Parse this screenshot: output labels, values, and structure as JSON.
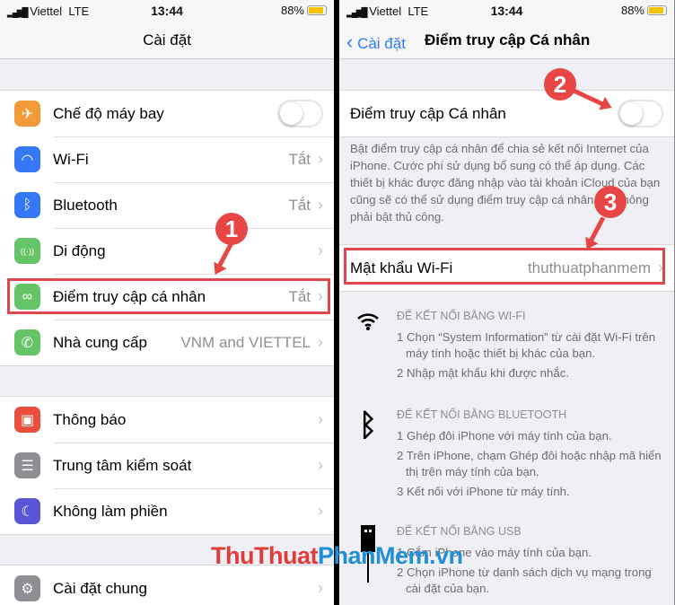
{
  "status": {
    "carrier": "Viettel",
    "network": "LTE",
    "time": "13:44",
    "battery": "88%",
    "battery_level": 0.88
  },
  "left": {
    "title": "Cài đặt",
    "groups": [
      [
        {
          "label": "Chế độ máy bay",
          "icon": "airplane-icon",
          "color": "#f19a37",
          "toggle": false
        },
        {
          "label": "Wi-Fi",
          "icon": "wifi-icon",
          "color": "#3478f6",
          "value": "Tắt"
        },
        {
          "label": "Bluetooth",
          "icon": "bluetooth-icon",
          "color": "#3478f6",
          "value": "Tắt"
        },
        {
          "label": "Di động",
          "icon": "cellular-icon",
          "color": "#65c466",
          "value": ""
        },
        {
          "label": "Điểm truy cập cá nhân",
          "icon": "hotspot-icon",
          "color": "#65c466",
          "value": "Tắt"
        },
        {
          "label": "Nhà cung cấp",
          "icon": "phone-icon",
          "color": "#65c466",
          "value": "VNM and VIETTEL"
        }
      ],
      [
        {
          "label": "Thông báo",
          "icon": "notification-icon",
          "color": "#eb4e3d"
        },
        {
          "label": "Trung tâm kiểm soát",
          "icon": "control-center-icon",
          "color": "#8e8e93"
        },
        {
          "label": "Không làm phiền",
          "icon": "moon-icon",
          "color": "#5856d6"
        }
      ],
      [
        {
          "label": "Cài đặt chung",
          "icon": "gear-icon",
          "color": "#8e8e93"
        }
      ]
    ]
  },
  "right": {
    "back": "Cài đặt",
    "title": "Điểm truy cập Cá nhân",
    "hotspot_label": "Điểm truy cập Cá nhân",
    "hotspot_on": false,
    "description": "Bật điểm truy cập cá nhân để chia sẻ kết nối Internet của iPhone. Cước phí sử dụng bổ sung có thể áp dụng. Các thiết bị khác được đăng nhập vào tài khoản iCloud của bạn cũng sẽ có thể sử dụng điểm truy cập cá nhân mà không phải bật thủ công.",
    "password_label": "Mật khẩu Wi-Fi",
    "password_value": "thuthuatphanmem",
    "sections": [
      {
        "icon": "wifi-icon",
        "heading": "ĐỂ KẾT NỐI BẰNG WI-FI",
        "steps": [
          "1 Chọn “System Information” từ cài đặt Wi-Fi trên máy tính hoặc thiết bị khác của bạn.",
          "2 Nhập mật khẩu khi được nhắc."
        ]
      },
      {
        "icon": "bluetooth-icon",
        "heading": "ĐỂ KẾT NỐI BẰNG BLUETOOTH",
        "steps": [
          "1 Ghép đôi iPhone với máy tính của bạn.",
          "2 Trên iPhone, chạm Ghép đôi hoặc nhập mã hiển thị trên máy tính của bạn.",
          "3 Kết nối với iPhone từ máy tính."
        ]
      },
      {
        "icon": "usb-icon",
        "heading": "ĐỂ KẾT NỐI BẰNG USB",
        "steps": [
          "1 Cắm iPhone vào máy tính của bạn.",
          "2 Chọn iPhone từ danh sách dịch vụ mạng trong cài đặt của bạn."
        ]
      }
    ]
  },
  "annotations": [
    "1",
    "2",
    "3"
  ],
  "watermark": {
    "part1": "ThuThuat",
    "part2": "PhanMem",
    "part3": ".vn"
  }
}
